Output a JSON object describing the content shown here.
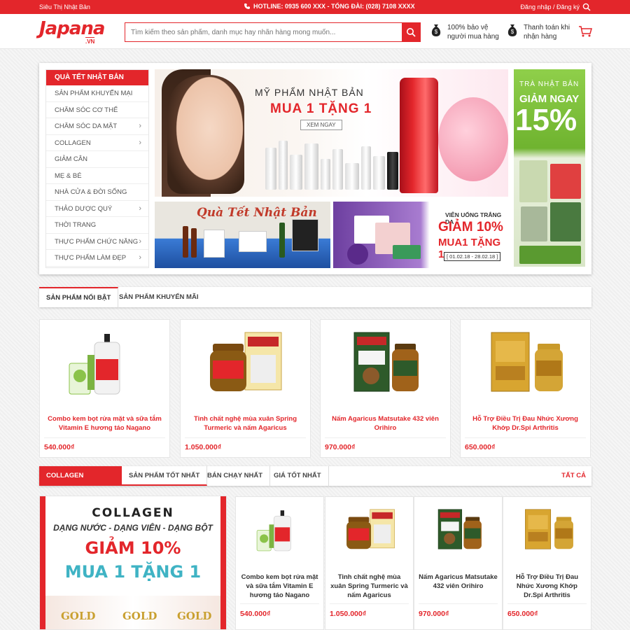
{
  "topbar": {
    "site_name": "Siêu Thị Nhật Bản",
    "hotline": "HOTLINE: 0935 600 XXX - TỔNG ĐÀI: (028) 7108 XXXX",
    "account": "Đăng nhập / Đăng ký"
  },
  "header": {
    "logo_text": "Japana",
    "logo_sub": ".VN",
    "search_placeholder": "Tìm kiếm theo sản phẩm, danh mục hay nhãn hàng mong muốn...",
    "feature1_line1": "100% bảo vệ",
    "feature1_line2": "người mua hàng",
    "feature2_line1": "Thanh toán khi",
    "feature2_line2": "nhận hàng"
  },
  "category_menu": {
    "title": "QUÀ TẾT NHẬT BẢN",
    "items": [
      {
        "label": "SẢN PHẨM KHUYẾN MẠI",
        "has_sub": false
      },
      {
        "label": "CHĂM SÓC CƠ THỂ",
        "has_sub": false
      },
      {
        "label": "CHĂM SÓC DA MẶT",
        "has_sub": true
      },
      {
        "label": "COLLAGEN",
        "has_sub": true
      },
      {
        "label": "GIẢM CÂN",
        "has_sub": false
      },
      {
        "label": "MẸ & BÉ",
        "has_sub": false
      },
      {
        "label": "NHÀ CỬA & ĐỜI SỐNG",
        "has_sub": false
      },
      {
        "label": "THẢO DƯỢC QUÝ",
        "has_sub": true
      },
      {
        "label": "THỜI TRANG",
        "has_sub": false
      },
      {
        "label": "THỰC PHẨM CHỨC NĂNG",
        "has_sub": true
      },
      {
        "label": "THỰC PHẨM LÀM ĐẸP",
        "has_sub": true
      }
    ]
  },
  "banners": {
    "main": {
      "line1": "MỸ PHẨM NHẬT BẢN",
      "line2": "MUA 1 TẶNG 1",
      "button": "XEM NGAY"
    },
    "tea": {
      "line1": "TRÀ NHẬT BẢN",
      "line2": "GIẢM NGAY",
      "line3": "15%"
    },
    "tet": {
      "title": "Quà Tết Nhật Bản"
    },
    "drink": {
      "line1": "VIÊN UỐNG TRẮNG DA",
      "line2": "GIẢM 10%",
      "line3": "MUA1 TẶNG 1",
      "dates": "[ 01.02.18 - 28.02.18 ]"
    }
  },
  "tabs1": {
    "featured": "SẢN PHẨM NỔI BẬT",
    "promo": "SẢN PHẨM KHUYẾN MÃI"
  },
  "products": [
    {
      "name": "Combo kem bọt rửa mặt và sữa tắm Vitamin E hương táo Nagano",
      "price": "540.000₫"
    },
    {
      "name": "Tinh chất nghệ mùa xuân Spring Turmeric và nấm Agaricus",
      "price": "1.050.000₫"
    },
    {
      "name": "Nấm Agaricus Matsutake 432 viên Orihiro",
      "price": "970.000₫"
    },
    {
      "name": "Hỗ Trợ Điều Trị Đau Nhức Xương Khớp Dr.Spi Arthritis",
      "price": "650.000₫"
    }
  ],
  "collagen_section": {
    "title": "COLLAGEN",
    "tabs": [
      "SẢN PHẨM TỐT NHẤT",
      "BÁN CHẠY NHẤT",
      "GIÁ TỐT NHẤT"
    ],
    "all": "TẤT CẢ",
    "promo": {
      "line1": "COLLAGEN",
      "line2": "DẠNG NƯỚC - DẠNG VIÊN - DẠNG BỘT",
      "line3": "GIẢM 10%",
      "line4": "MUA 1 TẶNG 1",
      "brand": "GOLD"
    }
  },
  "colors": {
    "accent": "#e3262b",
    "promo_teal": "#3fb3c4"
  }
}
